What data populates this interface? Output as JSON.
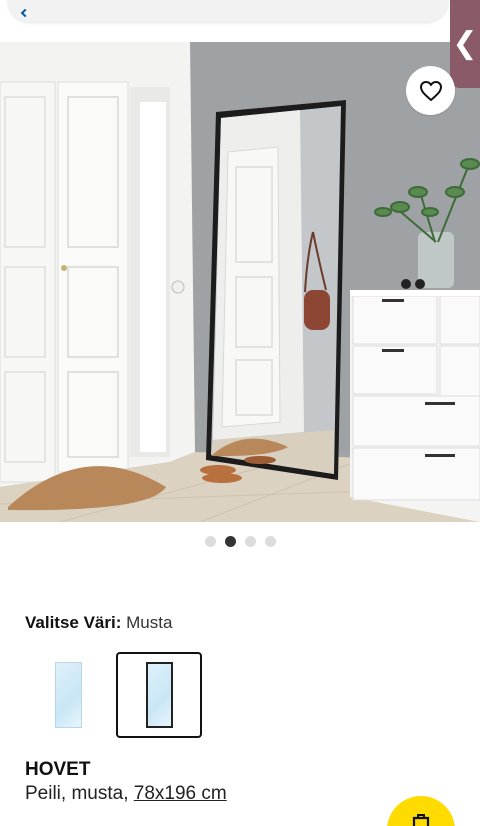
{
  "header": {
    "back_icon": "chevron-left-icon"
  },
  "side_tab": {
    "icon": "chevron-left-icon",
    "glyph": "❮",
    "color": "#8a5a68"
  },
  "hero": {
    "favorite_icon": "heart-icon",
    "carousel": {
      "count": 4,
      "active_index": 1
    }
  },
  "color_selector": {
    "label": "Valitse Väri:",
    "value": "Musta",
    "swatches": [
      {
        "name": "white-frame",
        "selected": false
      },
      {
        "name": "black-frame",
        "selected": true
      }
    ]
  },
  "product": {
    "name": "HOVET",
    "description": "Peili, musta,",
    "size": "78x196 cm"
  },
  "cart_button": {
    "icon": "shopping-bag-icon",
    "color": "#ffdb00"
  }
}
